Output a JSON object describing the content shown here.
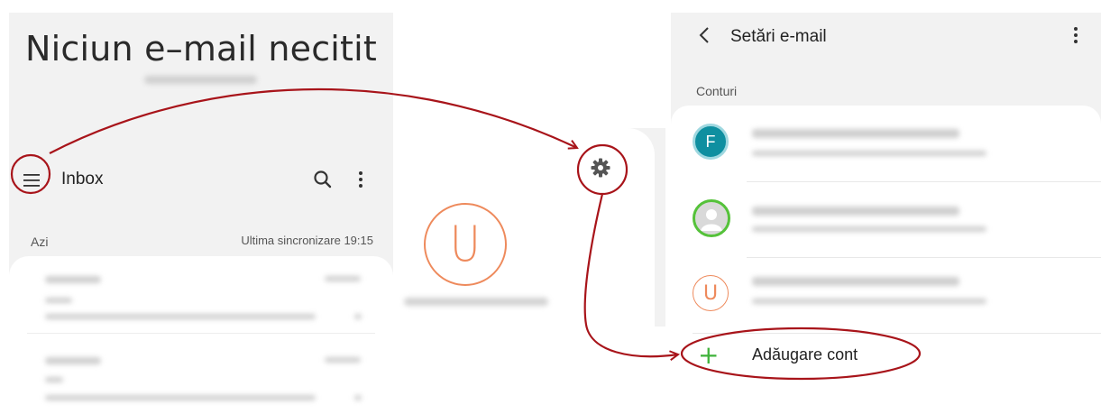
{
  "inbox_screen": {
    "title": "Niciun e–mail necitit",
    "folder_label": "Inbox",
    "icons": {
      "menu": "menu-icon",
      "search": "search-icon",
      "more": "more-vert-icon"
    },
    "section_label": "Azi",
    "sync_status": "Ultima sincronizare 19:15"
  },
  "drawer": {
    "avatar_letter": "U",
    "icons": {
      "settings": "gear-icon"
    },
    "accent_color": "#ee8a5c"
  },
  "settings_screen": {
    "title": "Setări e-mail",
    "icons": {
      "back": "chevron-left-icon",
      "more": "more-vert-icon",
      "add": "plus-icon"
    },
    "accounts_header": "Conturi",
    "accounts": [
      {
        "avatar_letter": "F",
        "avatar_color": "#0f8fa0"
      },
      {
        "avatar_letter": "",
        "avatar_color": "#55c23a"
      },
      {
        "avatar_letter": "U",
        "avatar_color": "#ee8a5c"
      }
    ],
    "add_account_label": "Adăugare cont",
    "add_color": "#3eb23a"
  },
  "annotation_color": "#a8141a"
}
